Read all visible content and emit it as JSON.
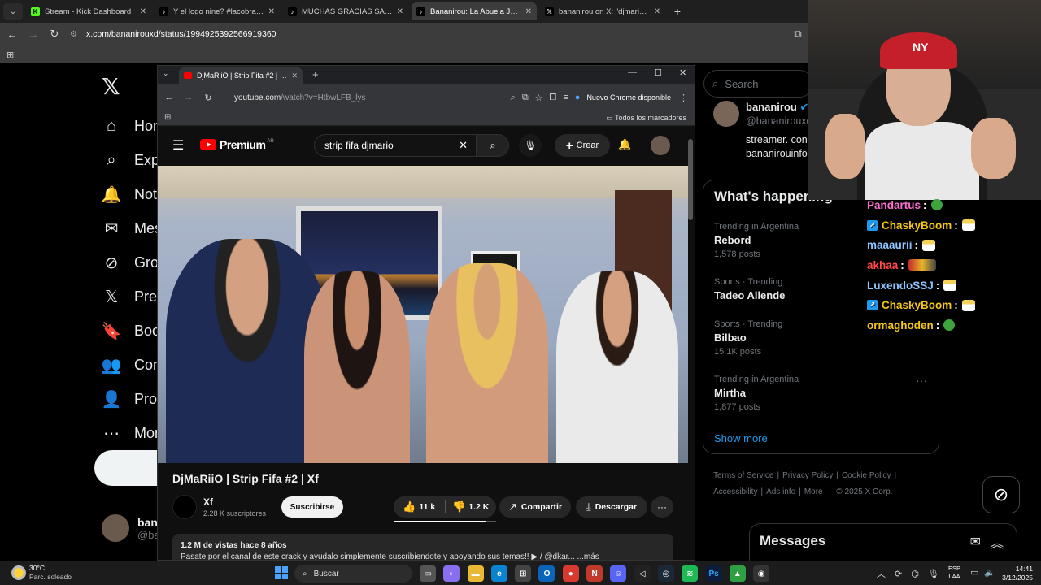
{
  "outer_browser": {
    "tabs": [
      {
        "title": "Stream - Kick Dashboard",
        "favicon": "K",
        "favicon_color": "#53fc18",
        "active": false
      },
      {
        "title": "Y el logo nine? #lacobraaa #da",
        "favicon": "♪",
        "favicon_color": "#000000",
        "active": false
      },
      {
        "title": "MUCHAS GRACIAS SAMMY PO",
        "favicon": "♪",
        "favicon_color": "#000000",
        "active": false
      },
      {
        "title": "Bananirou: La Abuela Joseador",
        "favicon": "♪",
        "favicon_color": "#000000",
        "active": true
      },
      {
        "title": "bananirou on X: \"djmario se bu",
        "favicon": "𝕏",
        "favicon_color": "#000000",
        "active": false
      }
    ],
    "url": "x.com/bananirouxd/status/1994925392566919360"
  },
  "x": {
    "nav": [
      {
        "label": "Home",
        "icon": "⌂"
      },
      {
        "label": "Explore",
        "icon": "⌕"
      },
      {
        "label": "Notifications",
        "icon": "🔔"
      },
      {
        "label": "Messages",
        "icon": "✉"
      },
      {
        "label": "Grok",
        "icon": "⊘"
      },
      {
        "label": "Premium",
        "icon": "𝕏"
      },
      {
        "label": "Bookmarks",
        "icon": "🔖"
      },
      {
        "label": "Communities",
        "icon": "👥"
      },
      {
        "label": "Profile",
        "icon": "👤"
      },
      {
        "label": "More",
        "icon": "⋯"
      }
    ],
    "nav_visible": [
      "Hon",
      "Exp",
      "Not",
      "Mes",
      "Gro",
      "Pre",
      "Boo",
      "Con",
      "Prof",
      "Mor"
    ],
    "account_name": "bana",
    "account_handle": "@ba",
    "search_placeholder": "Search",
    "profile": {
      "name": "bananirou",
      "handle": "@bananirouxd",
      "bio1": "streamer. con",
      "bio2": "bananirouinfo"
    },
    "trends_title": "What's happening",
    "trends": [
      {
        "category": "Trending in Argentina",
        "name": "Rebord",
        "count": "1,578 posts"
      },
      {
        "category": "Sports · Trending",
        "name": "Tadeo Allende",
        "count": ""
      },
      {
        "category": "Sports · Trending",
        "name": "Bilbao",
        "count": "15.1K posts"
      },
      {
        "category": "Trending in Argentina",
        "name": "Mirtha",
        "count": "1,877 posts"
      }
    ],
    "show_more": "Show more",
    "footer": [
      "Terms of Service",
      "|",
      "Privacy Policy",
      "|",
      "Cookie Policy",
      "|",
      "Accessibility",
      "|",
      "Ads info",
      "|",
      "More ···",
      "© 2025 X Corp."
    ],
    "messages_title": "Messages"
  },
  "youtube_window": {
    "tab_title": "DjMaRiiO | Strip Fifa #2 | Xf - YouTube",
    "url_main": "youtube.com",
    "url_path": "/watch?v=HtbwLFB_lys",
    "update_label": "Nuevo Chrome disponible",
    "bookmarks_label": "Todos los marcadores",
    "logo_text": "Premium",
    "logo_region": "AR",
    "search_value": "strip fifa djmario",
    "create_label": "Crear",
    "video_title": "DjMaRiiO | Strip Fifa #2 | Xf",
    "channel_name": "Xf",
    "channel_subs": "2.28 K suscriptores",
    "subscribe_label": "Suscribirse",
    "likes": "11 k",
    "dislikes": "1.2 K",
    "like_ratio": 0.9,
    "share_label": "Compartir",
    "download_label": "Descargar",
    "desc_meta": "1.2 M de vistas  hace 8 años",
    "desc_line": "Pasate por el canal de este crack y ayudalo simplemente suscribiendote y apoyando sus temas!!  ▶ / @dkar...  ...más"
  },
  "chat": [
    {
      "user": "Pandartus",
      "color": "#ff6fd2",
      "badge": false,
      "emote": "green"
    },
    {
      "user": "ChaskyBoom",
      "color": "#f5c518",
      "badge": true,
      "emote": "cup"
    },
    {
      "user": "maaaurii",
      "color": "#8ec5ff",
      "badge": false,
      "emote": "cup"
    },
    {
      "user": "akhaa",
      "color": "#ff4b4b",
      "badge": false,
      "emote": "gif"
    },
    {
      "user": "LuxendoSSJ",
      "color": "#8ec5ff",
      "badge": false,
      "emote": "cup"
    },
    {
      "user": "ChaskyBoom",
      "color": "#f5c518",
      "badge": true,
      "emote": "cup"
    },
    {
      "user": "ormaghoden",
      "color": "#f5c518",
      "badge": false,
      "emote": "green"
    }
  ],
  "taskbar": {
    "temp": "30°C",
    "weather": "Parc. soleado",
    "search_label": "Buscar",
    "lang_line1": "ESP",
    "lang_line2": "LAA",
    "time": "14:41",
    "date": "3/12/2025"
  }
}
